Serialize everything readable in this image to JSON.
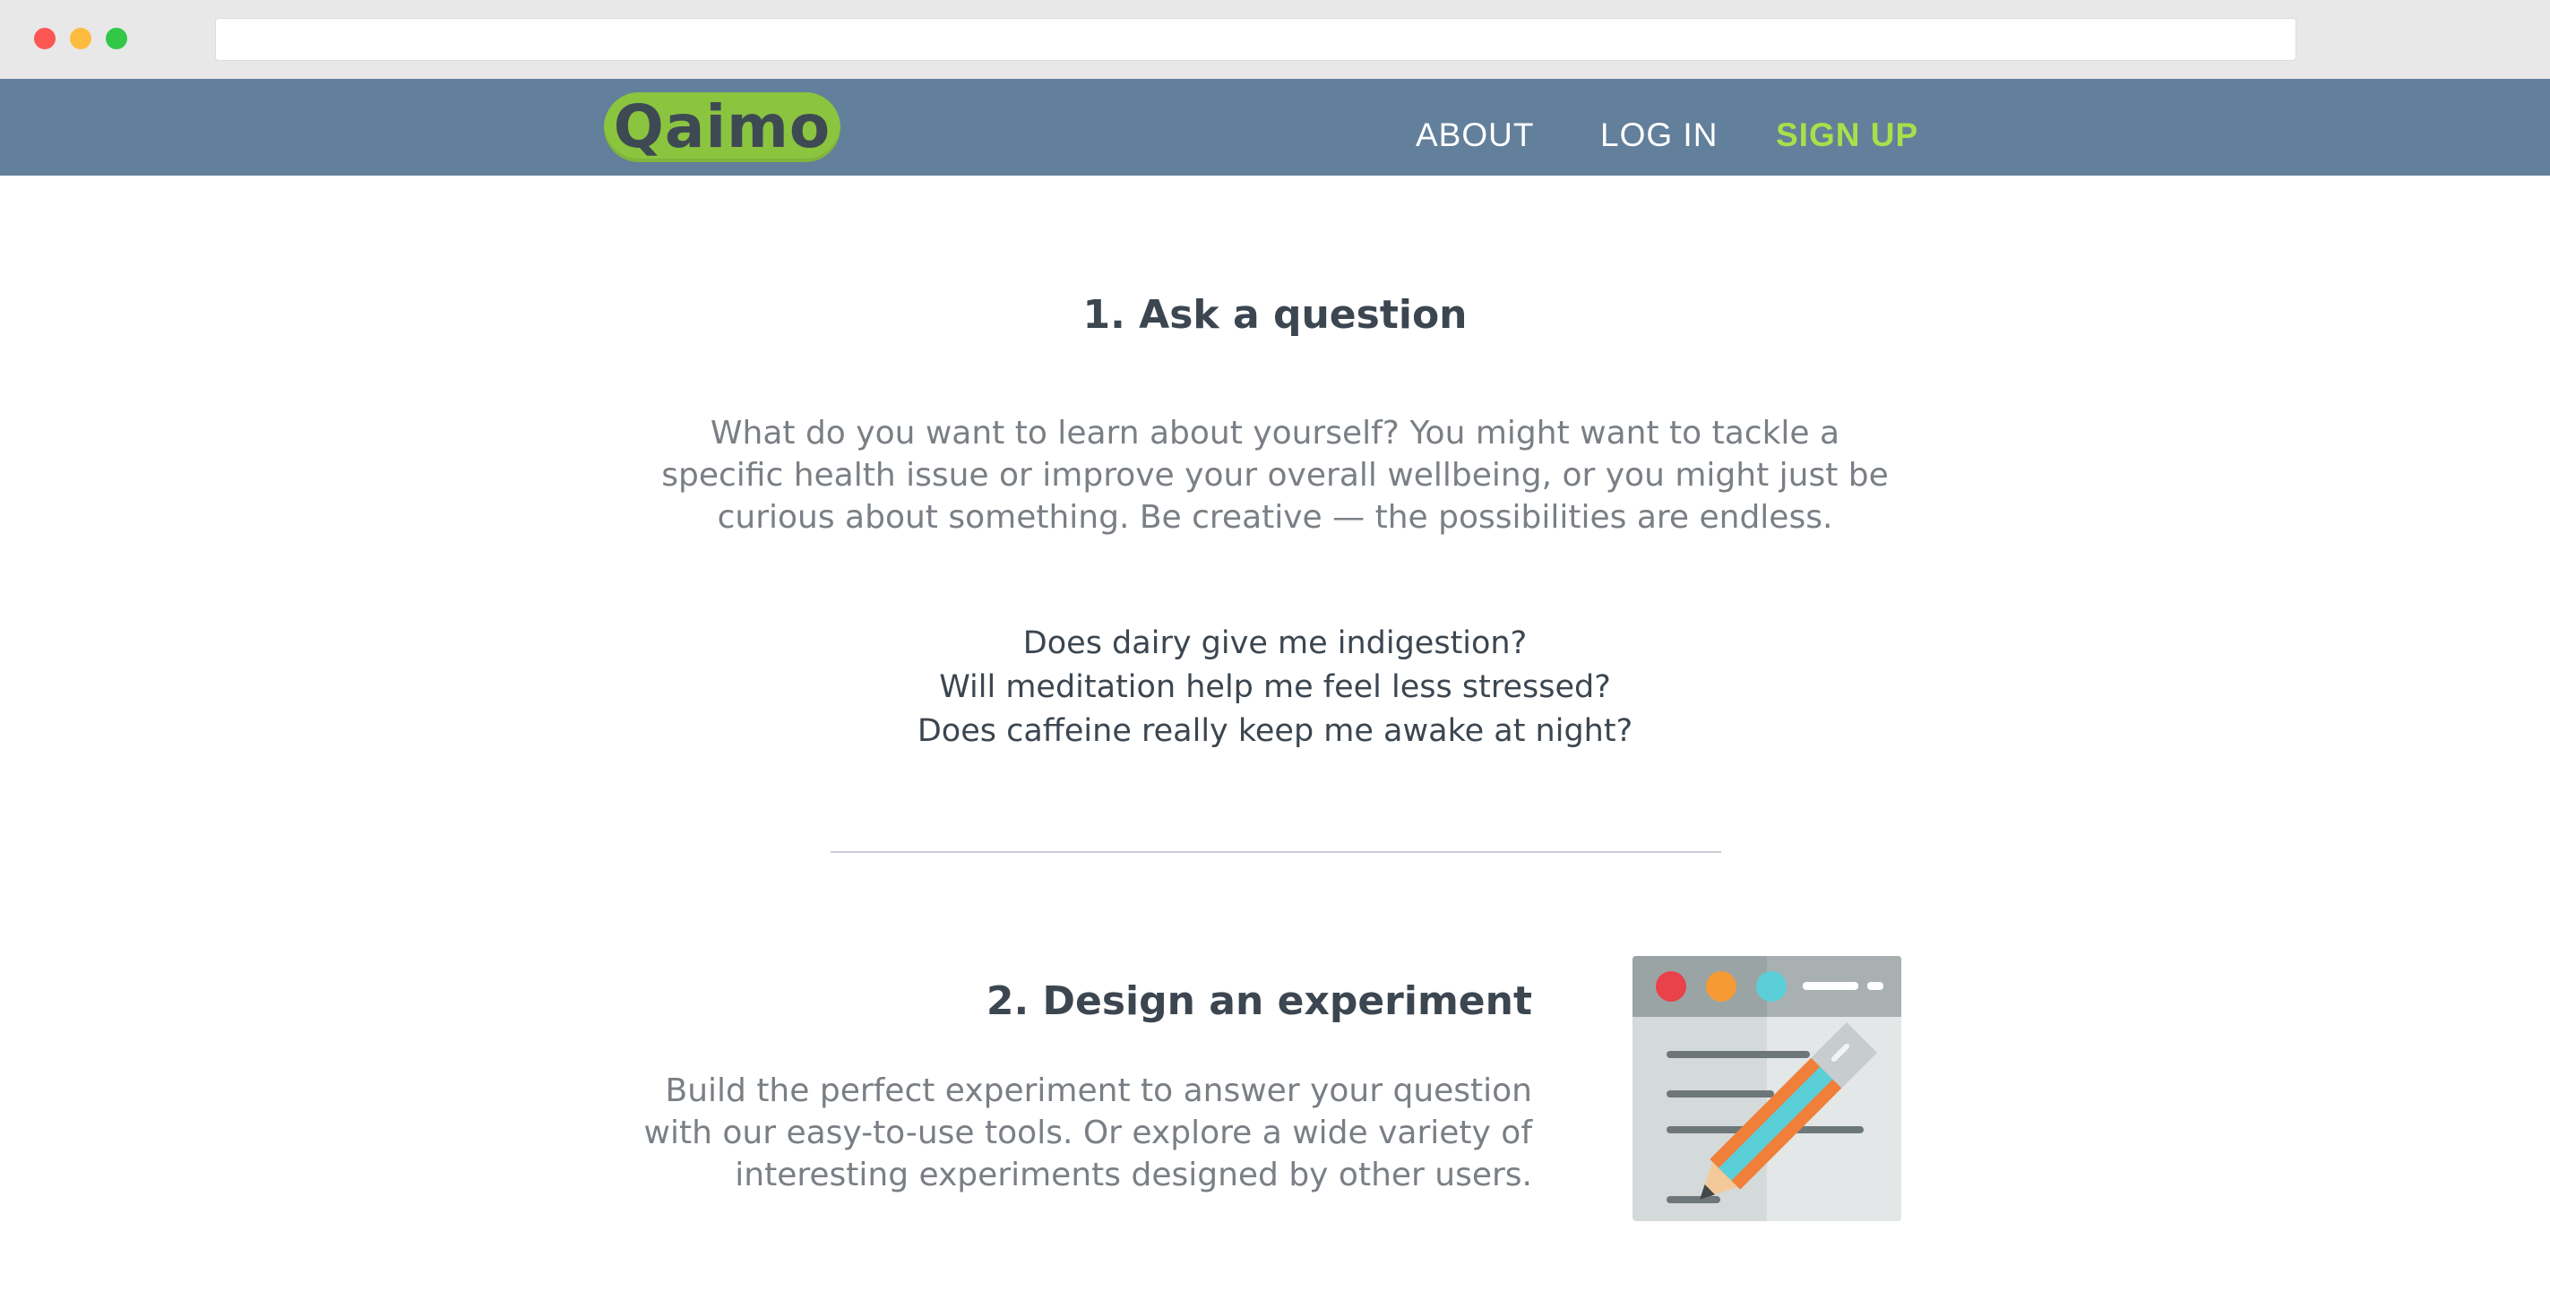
{
  "nav": {
    "logo": "Qaimo",
    "about": "ABOUT",
    "login": "LOG IN",
    "signup": "SIGN UP"
  },
  "step1": {
    "title": "1.  Ask a question",
    "body": "What do you want to learn about yourself? You might want to tackle a specific health issue or improve your overall wellbeing, or you might just be curious about something. Be creative — the possibilities are endless.",
    "examples": [
      "Does dairy give me indigestion?",
      "Will meditation help me feel less stressed?",
      "Does caffeine really keep me awake at night?"
    ]
  },
  "step2": {
    "title": "2.  Design an experiment",
    "body": "Build the perfect experiment to answer your question with our easy-to-use tools. Or explore a wide variety of interesting experiments designed by other users.",
    "illustration_icon": "pencil-document-icon"
  },
  "colors": {
    "nav_bg": "#627f9b",
    "logo_bg": "#8bc43f",
    "signup": "#a6e04a",
    "heading": "#3c4650",
    "body_text": "#7a7f85"
  }
}
